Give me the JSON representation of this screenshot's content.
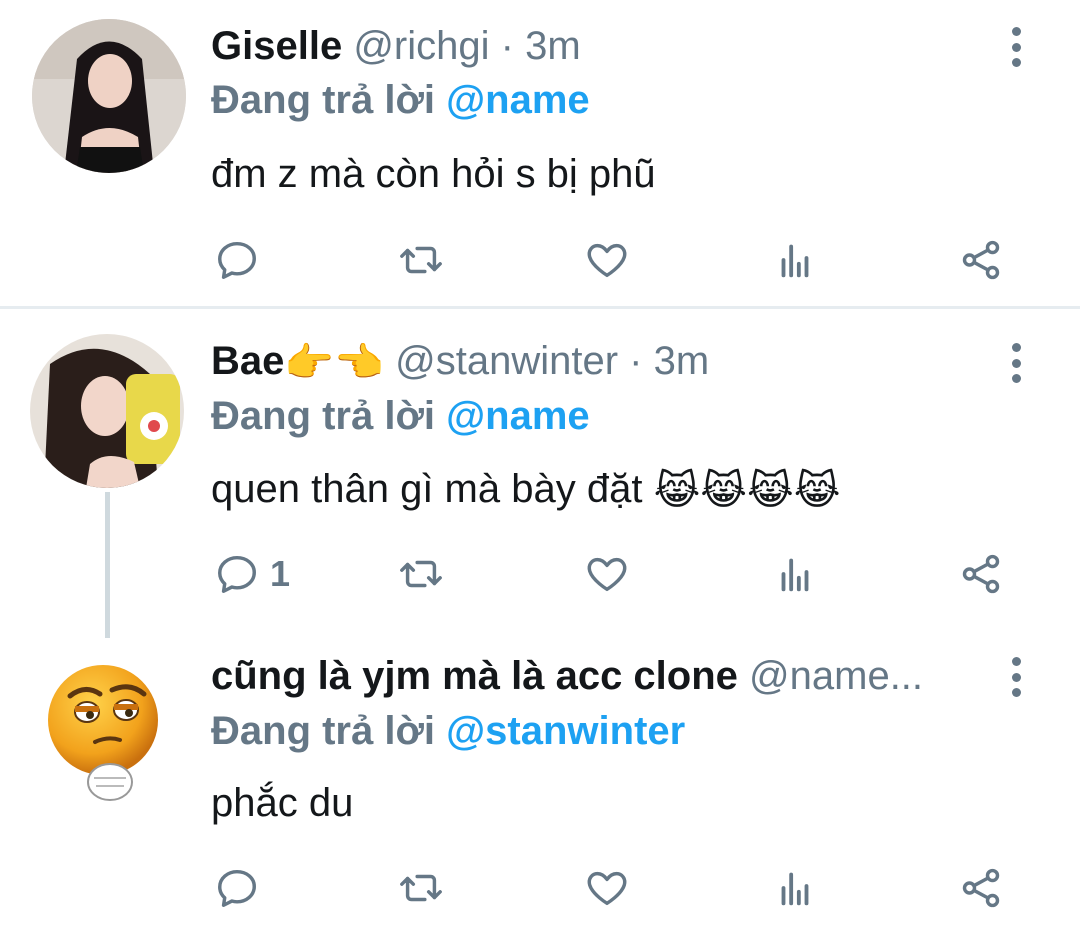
{
  "tweets": [
    {
      "name": "Giselle",
      "handle": "@richgi",
      "dot": "·",
      "time": "3m",
      "reply_prefix": "Đang trả lời",
      "reply_to": "@name",
      "text": "đm z mà còn hỏi s bị phũ",
      "reply_count": "",
      "avatar": "woman-black-hair-photo"
    },
    {
      "name": "Bae",
      "name_emoji": "👉👈",
      "handle": "@stanwinter",
      "dot": "·",
      "time": "3m",
      "reply_prefix": "Đang trả lời",
      "reply_to": "@name",
      "text": "quen thân gì mà bày đặt",
      "text_emoji": "😹😹😹😹",
      "reply_count": "1",
      "avatar": "woman-selfie-photo"
    },
    {
      "name": "cũng là yjm mà là acc clone",
      "handle": "@name...",
      "reply_prefix": "Đang trả lời",
      "reply_to": "@stanwinter",
      "text": "phắc du",
      "reply_count": "",
      "avatar": "smirking-emoji-avatar"
    }
  ],
  "colors": {
    "accent": "#1da1f2",
    "secondary_text": "#657786",
    "divider": "#e6ecf0"
  },
  "icons": [
    "reply-icon",
    "retweet-icon",
    "like-icon",
    "analytics-icon",
    "share-icon",
    "more-icon"
  ]
}
